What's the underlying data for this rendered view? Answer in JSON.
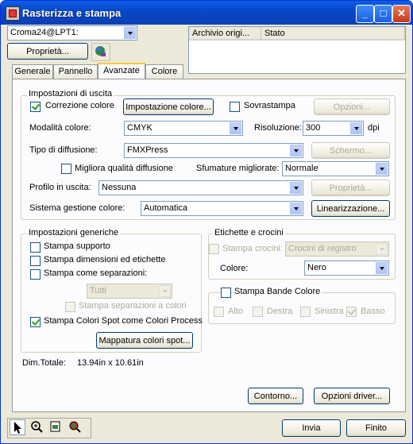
{
  "window": {
    "title": "Rasterizza e stampa"
  },
  "printer": {
    "selected": "Croma24@LPT1:",
    "properties_label": "Proprietà..."
  },
  "queue": {
    "columns": [
      "Archivio origi...",
      "Stato"
    ]
  },
  "tabs": [
    "Generale",
    "Pannello",
    "Avanzate",
    "Colore"
  ],
  "active_tab": "Avanzate",
  "output": {
    "group_label": "Impostazioni di uscita",
    "color_correction_label": "Correzione colore",
    "color_settings_button": "Impostazione colore...",
    "overprint_label": "Sovrastampa",
    "options_button": "Opzioni...",
    "color_mode_label": "Modalità colore:",
    "color_mode_value": "CMYK",
    "resolution_label": "Risoluzione:",
    "resolution_value": "300",
    "resolution_unit": "dpi",
    "diffusion_label": "Tipo di diffusione:",
    "diffusion_value": "FMXPress",
    "screen_button": "Schermo...",
    "improve_diffusion_label": "Migliora qualità diffusione",
    "improved_shading_label": "Sfumature migliorate:",
    "improved_shading_value": "Normale",
    "output_profile_label": "Profilo in uscita:",
    "output_profile_value": "Nessuna",
    "profile_properties_button": "Proprietà...",
    "cms_label": "Sistema gestione colore:",
    "cms_value": "Automatica",
    "linearization_button": "Linearizzazione..."
  },
  "generic": {
    "group_label": "Impostazioni generiche",
    "print_media_label": "Stampa supporto",
    "print_dims_label": "Stampa dimensioni ed etichette",
    "print_separations_label": "Stampa come separazioni:",
    "separations_value": "Tutti",
    "color_separations_label": "Stampa separazioni a colori",
    "spot_as_process_label": "Stampa Colori Spot come Colori Process",
    "spot_mapping_button": "Mappatura colori spot..."
  },
  "labels": {
    "group_label": "Etichette e crocini",
    "print_marks_label": "Stampa crocini:",
    "marks_value": "Crocini di registro",
    "color_label": "Colore:",
    "color_value": "Nero"
  },
  "bands": {
    "label": "Stampa Bande Colore",
    "top_label": "Alto",
    "right_label": "Destra",
    "left_label": "Sinistra",
    "bottom_label": "Basso"
  },
  "dimensions": {
    "label": "Dim.Totale:",
    "value": "13.94in x 10.61in"
  },
  "bottom": {
    "contour_button": "Contorno...",
    "driver_options_button": "Opzioni driver...",
    "send_button": "Invia",
    "done_button": "Finito"
  },
  "colors": {
    "titlebar": "#0a5ee8",
    "window_bg": "#ece9d8",
    "check": "#21a121"
  }
}
